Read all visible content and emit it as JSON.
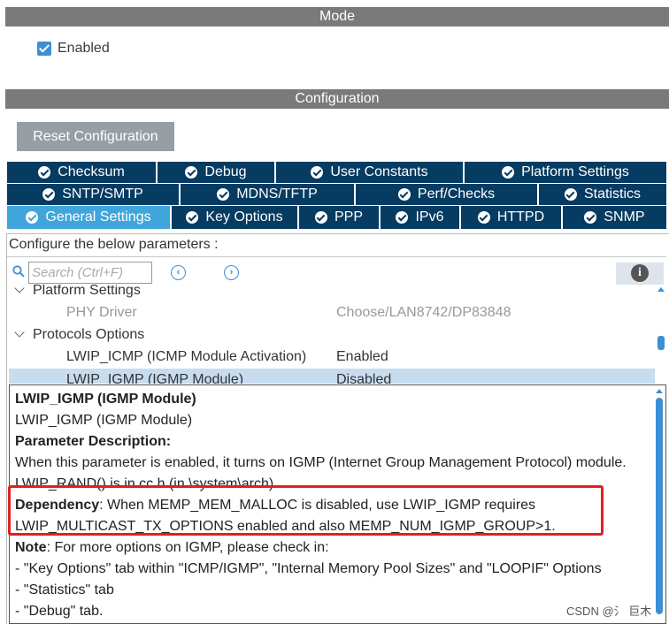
{
  "mode": {
    "title": "Mode",
    "enabled_label": "Enabled"
  },
  "configuration": {
    "title": "Configuration",
    "reset_label": "Reset Configuration"
  },
  "tabs": {
    "row1": [
      {
        "label": "Checksum"
      },
      {
        "label": "Debug"
      },
      {
        "label": "User Constants"
      },
      {
        "label": "Platform Settings"
      }
    ],
    "row2": [
      {
        "label": "SNTP/SMTP"
      },
      {
        "label": "MDNS/TFTP"
      },
      {
        "label": "Perf/Checks"
      },
      {
        "label": "Statistics"
      }
    ],
    "row3": [
      {
        "label": "General Settings",
        "active": true
      },
      {
        "label": "Key Options"
      },
      {
        "label": "PPP"
      },
      {
        "label": "IPv6"
      },
      {
        "label": "HTTPD"
      },
      {
        "label": "SNMP"
      }
    ]
  },
  "params": {
    "header": "Configure the below parameters :",
    "search_placeholder": "Search (Ctrl+F)",
    "prev_icon": "chevron-left-circle",
    "next_icon": "chevron-right-circle",
    "info_symbol": "i",
    "tree": {
      "platform_settings": "Platform Settings",
      "phy_driver": {
        "name": "PHY Driver",
        "value": "Choose/LAN8742/DP83848"
      },
      "protocols_options": "Protocols Options",
      "lwip_icmp": {
        "name": "LWIP_ICMP (ICMP Module Activation)",
        "value": "Enabled"
      },
      "lwip_igmp": {
        "name": "LWIP_IGMP (IGMP Module)",
        "value": "Disabled"
      }
    }
  },
  "description": {
    "title": "LWIP_IGMP (IGMP Module)",
    "subtitle": "LWIP_IGMP (IGMP Module)",
    "param_desc_label": "Parameter Description:",
    "param_desc_text": "When this parameter is enabled, it turns on IGMP (Internet Group Management Protocol) module.",
    "rand_text": "LWIP_RAND() is in cc.h (in \\system\\arch)",
    "dependency_label": "Dependency",
    "dependency_text1": ": When MEMP_MEM_MALLOC is disabled, use LWIP_IGMP requires",
    "dependency_text2": "LWIP_MULTICAST_TX_OPTIONS enabled and also MEMP_NUM_IGMP_GROUP>1.",
    "note_label": "Note",
    "note_text": ": For more options on IGMP, please check in:",
    "note_item1": "- \"Key Options\" tab within \"ICMP/IGMP\", \"Internal Memory Pool Sizes\" and \"LOOPIF\" Options",
    "note_item2": "- \"Statistics\" tab",
    "note_item3": "- \"Debug\" tab."
  },
  "watermark": "CSDN @氵 巨木",
  "colors": {
    "tab_bg": "#063b62",
    "tab_active": "#3fa5db",
    "header_bar": "#7a7a7a",
    "highlight": "#e02020"
  }
}
